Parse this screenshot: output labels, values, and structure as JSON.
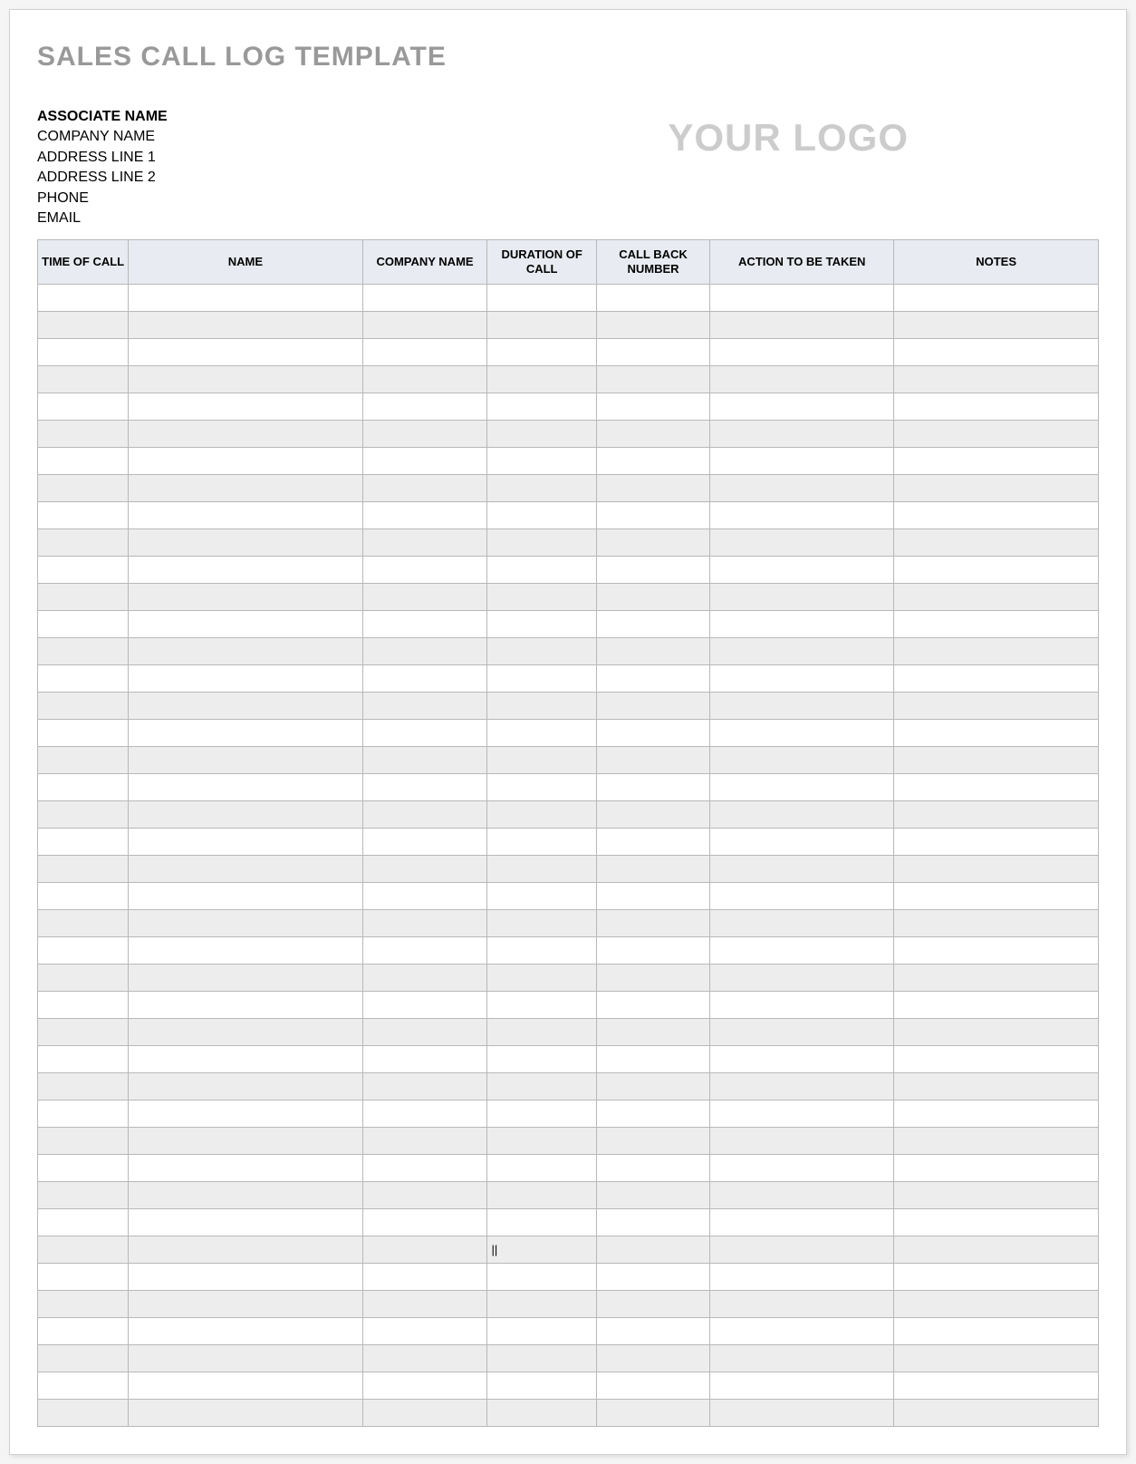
{
  "title": "SALES CALL LOG TEMPLATE",
  "associate": {
    "name_label": "ASSOCIATE NAME",
    "company": "COMPANY NAME",
    "address1": "ADDRESS LINE 1",
    "address2": "ADDRESS LINE 2",
    "phone": "PHONE",
    "email": "EMAIL"
  },
  "logo_text": "YOUR LOGO",
  "table": {
    "headers": {
      "time_of_call": "TIME OF CALL",
      "name": "NAME",
      "company_name": "COMPANY NAME",
      "duration_of_call": "DURATION OF CALL",
      "call_back_number": "CALL BACK NUMBER",
      "action_to_be_taken": "ACTION TO BE TAKEN",
      "notes": "NOTES"
    },
    "rows": [
      {
        "time_of_call": "",
        "name": "",
        "company_name": "",
        "duration_of_call": "",
        "call_back_number": "",
        "action_to_be_taken": "",
        "notes": ""
      },
      {
        "time_of_call": "",
        "name": "",
        "company_name": "",
        "duration_of_call": "",
        "call_back_number": "",
        "action_to_be_taken": "",
        "notes": ""
      },
      {
        "time_of_call": "",
        "name": "",
        "company_name": "",
        "duration_of_call": "",
        "call_back_number": "",
        "action_to_be_taken": "",
        "notes": ""
      },
      {
        "time_of_call": "",
        "name": "",
        "company_name": "",
        "duration_of_call": "",
        "call_back_number": "",
        "action_to_be_taken": "",
        "notes": ""
      },
      {
        "time_of_call": "",
        "name": "",
        "company_name": "",
        "duration_of_call": "",
        "call_back_number": "",
        "action_to_be_taken": "",
        "notes": ""
      },
      {
        "time_of_call": "",
        "name": "",
        "company_name": "",
        "duration_of_call": "",
        "call_back_number": "",
        "action_to_be_taken": "",
        "notes": ""
      },
      {
        "time_of_call": "",
        "name": "",
        "company_name": "",
        "duration_of_call": "",
        "call_back_number": "",
        "action_to_be_taken": "",
        "notes": ""
      },
      {
        "time_of_call": "",
        "name": "",
        "company_name": "",
        "duration_of_call": "",
        "call_back_number": "",
        "action_to_be_taken": "",
        "notes": ""
      },
      {
        "time_of_call": "",
        "name": "",
        "company_name": "",
        "duration_of_call": "",
        "call_back_number": "",
        "action_to_be_taken": "",
        "notes": ""
      },
      {
        "time_of_call": "",
        "name": "",
        "company_name": "",
        "duration_of_call": "",
        "call_back_number": "",
        "action_to_be_taken": "",
        "notes": ""
      },
      {
        "time_of_call": "",
        "name": "",
        "company_name": "",
        "duration_of_call": "",
        "call_back_number": "",
        "action_to_be_taken": "",
        "notes": ""
      },
      {
        "time_of_call": "",
        "name": "",
        "company_name": "",
        "duration_of_call": "",
        "call_back_number": "",
        "action_to_be_taken": "",
        "notes": ""
      },
      {
        "time_of_call": "",
        "name": "",
        "company_name": "",
        "duration_of_call": "",
        "call_back_number": "",
        "action_to_be_taken": "",
        "notes": ""
      },
      {
        "time_of_call": "",
        "name": "",
        "company_name": "",
        "duration_of_call": "",
        "call_back_number": "",
        "action_to_be_taken": "",
        "notes": ""
      },
      {
        "time_of_call": "",
        "name": "",
        "company_name": "",
        "duration_of_call": "",
        "call_back_number": "",
        "action_to_be_taken": "",
        "notes": ""
      },
      {
        "time_of_call": "",
        "name": "",
        "company_name": "",
        "duration_of_call": "",
        "call_back_number": "",
        "action_to_be_taken": "",
        "notes": ""
      },
      {
        "time_of_call": "",
        "name": "",
        "company_name": "",
        "duration_of_call": "",
        "call_back_number": "",
        "action_to_be_taken": "",
        "notes": ""
      },
      {
        "time_of_call": "",
        "name": "",
        "company_name": "",
        "duration_of_call": "",
        "call_back_number": "",
        "action_to_be_taken": "",
        "notes": ""
      },
      {
        "time_of_call": "",
        "name": "",
        "company_name": "",
        "duration_of_call": "",
        "call_back_number": "",
        "action_to_be_taken": "",
        "notes": ""
      },
      {
        "time_of_call": "",
        "name": "",
        "company_name": "",
        "duration_of_call": "",
        "call_back_number": "",
        "action_to_be_taken": "",
        "notes": ""
      },
      {
        "time_of_call": "",
        "name": "",
        "company_name": "",
        "duration_of_call": "",
        "call_back_number": "",
        "action_to_be_taken": "",
        "notes": ""
      },
      {
        "time_of_call": "",
        "name": "",
        "company_name": "",
        "duration_of_call": "",
        "call_back_number": "",
        "action_to_be_taken": "",
        "notes": ""
      },
      {
        "time_of_call": "",
        "name": "",
        "company_name": "",
        "duration_of_call": "",
        "call_back_number": "",
        "action_to_be_taken": "",
        "notes": ""
      },
      {
        "time_of_call": "",
        "name": "",
        "company_name": "",
        "duration_of_call": "",
        "call_back_number": "",
        "action_to_be_taken": "",
        "notes": ""
      },
      {
        "time_of_call": "",
        "name": "",
        "company_name": "",
        "duration_of_call": "",
        "call_back_number": "",
        "action_to_be_taken": "",
        "notes": ""
      },
      {
        "time_of_call": "",
        "name": "",
        "company_name": "",
        "duration_of_call": "",
        "call_back_number": "",
        "action_to_be_taken": "",
        "notes": ""
      },
      {
        "time_of_call": "",
        "name": "",
        "company_name": "",
        "duration_of_call": "",
        "call_back_number": "",
        "action_to_be_taken": "",
        "notes": ""
      },
      {
        "time_of_call": "",
        "name": "",
        "company_name": "",
        "duration_of_call": "",
        "call_back_number": "",
        "action_to_be_taken": "",
        "notes": ""
      },
      {
        "time_of_call": "",
        "name": "",
        "company_name": "",
        "duration_of_call": "",
        "call_back_number": "",
        "action_to_be_taken": "",
        "notes": ""
      },
      {
        "time_of_call": "",
        "name": "",
        "company_name": "",
        "duration_of_call": "",
        "call_back_number": "",
        "action_to_be_taken": "",
        "notes": ""
      },
      {
        "time_of_call": "",
        "name": "",
        "company_name": "",
        "duration_of_call": "",
        "call_back_number": "",
        "action_to_be_taken": "",
        "notes": ""
      },
      {
        "time_of_call": "",
        "name": "",
        "company_name": "",
        "duration_of_call": "",
        "call_back_number": "",
        "action_to_be_taken": "",
        "notes": ""
      },
      {
        "time_of_call": "",
        "name": "",
        "company_name": "",
        "duration_of_call": "",
        "call_back_number": "",
        "action_to_be_taken": "",
        "notes": ""
      },
      {
        "time_of_call": "",
        "name": "",
        "company_name": "",
        "duration_of_call": "",
        "call_back_number": "",
        "action_to_be_taken": "",
        "notes": ""
      },
      {
        "time_of_call": "",
        "name": "",
        "company_name": "",
        "duration_of_call": "",
        "call_back_number": "",
        "action_to_be_taken": "",
        "notes": ""
      },
      {
        "time_of_call": "",
        "name": "",
        "company_name": "",
        "duration_of_call": "||",
        "call_back_number": "",
        "action_to_be_taken": "",
        "notes": ""
      },
      {
        "time_of_call": "",
        "name": "",
        "company_name": "",
        "duration_of_call": "",
        "call_back_number": "",
        "action_to_be_taken": "",
        "notes": ""
      },
      {
        "time_of_call": "",
        "name": "",
        "company_name": "",
        "duration_of_call": "",
        "call_back_number": "",
        "action_to_be_taken": "",
        "notes": ""
      },
      {
        "time_of_call": "",
        "name": "",
        "company_name": "",
        "duration_of_call": "",
        "call_back_number": "",
        "action_to_be_taken": "",
        "notes": ""
      },
      {
        "time_of_call": "",
        "name": "",
        "company_name": "",
        "duration_of_call": "",
        "call_back_number": "",
        "action_to_be_taken": "",
        "notes": ""
      },
      {
        "time_of_call": "",
        "name": "",
        "company_name": "",
        "duration_of_call": "",
        "call_back_number": "",
        "action_to_be_taken": "",
        "notes": ""
      },
      {
        "time_of_call": "",
        "name": "",
        "company_name": "",
        "duration_of_call": "",
        "call_back_number": "",
        "action_to_be_taken": "",
        "notes": ""
      }
    ]
  }
}
